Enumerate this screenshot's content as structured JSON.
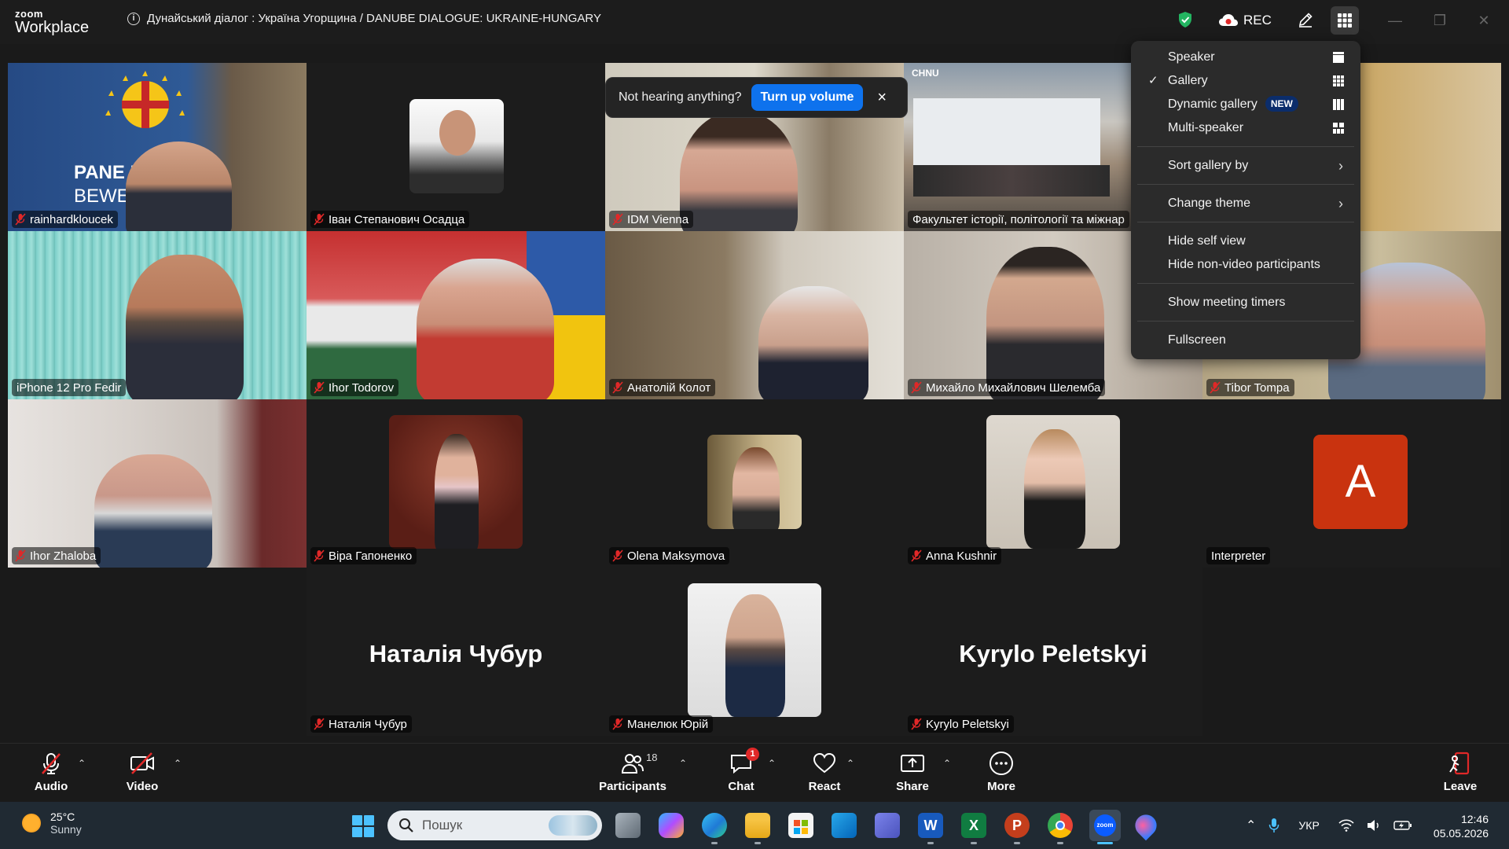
{
  "app": {
    "brand_top": "zoom",
    "brand_bottom": "Workplace"
  },
  "meeting": {
    "title": "Дунайський діалог : Україна Угорщина / DANUBE DIALOGUE: UKRAINE-HUNGARY"
  },
  "header": {
    "rec_label": "REC"
  },
  "notification": {
    "text": "Not hearing anything?",
    "button": "Turn up volume",
    "close": "×"
  },
  "view_menu": {
    "items": [
      {
        "label": "Speaker",
        "checked": false
      },
      {
        "label": "Gallery",
        "checked": true
      },
      {
        "label": "Dynamic gallery",
        "badge": "NEW",
        "checked": false
      },
      {
        "label": "Multi-speaker",
        "checked": false
      }
    ],
    "sort_gallery": "Sort gallery by",
    "change_theme": "Change theme",
    "hide_self": "Hide self view",
    "hide_nonvideo": "Hide non-video participants",
    "show_timers": "Show meeting timers",
    "fullscreen": "Fullscreen",
    "check_mark": "✓"
  },
  "participants": [
    {
      "name": "rainhardkloucek",
      "muted": true
    },
    {
      "name": "Іван Степанович Осадца",
      "muted": true
    },
    {
      "name": "IDM Vienna",
      "muted": true
    },
    {
      "name": "Факультет історії, політології та міжнар",
      "muted": false
    },
    {
      "name": "iPhone 12 Pro Fedir",
      "muted": false
    },
    {
      "name": "Ihor Todorov",
      "muted": true
    },
    {
      "name": "Анатолій Колот",
      "muted": true
    },
    {
      "name": "Михайло Михайлович Шелемба",
      "muted": true
    },
    {
      "name": "Tibor Tompa",
      "muted": true
    },
    {
      "name": "Ihor Zhaloba",
      "muted": true
    },
    {
      "name": "Віра Гапоненко",
      "muted": true
    },
    {
      "name": "Olena Maksymova",
      "muted": true
    },
    {
      "name": "Anna Kushnir",
      "muted": true
    },
    {
      "name": "Interpreter",
      "muted": false,
      "avatar_letter": "A"
    },
    {
      "name": "Наталія Чубур",
      "muted": true,
      "big_name": "Наталія Чубур"
    },
    {
      "name": "Манелюк Юрій",
      "muted": true
    },
    {
      "name": "Kyrylo Peletskyi",
      "muted": true,
      "big_name": "Kyrylo Peletskyi"
    }
  ],
  "tile_texts": {
    "panel_sign_1": "PANE  ROPA",
    "panel_sign_2": "BEWE  NG",
    "university_logo": "CHNU"
  },
  "toolbar": {
    "audio": "Audio",
    "video": "Video",
    "participants": "Participants",
    "participants_count": "18",
    "chat": "Chat",
    "chat_badge": "1",
    "react": "React",
    "share": "Share",
    "more": "More",
    "leave": "Leave"
  },
  "taskbar": {
    "temp": "25°C",
    "weather": "Sunny",
    "search_placeholder": "Пошук",
    "lang": "УКР",
    "time": "12:46",
    "date": "05.05.2026"
  },
  "colors": {
    "accent": "#0e72ed",
    "active_speaker": "#2dd37a",
    "muted_red": "#e02828",
    "avatar_orange": "#c9330f"
  }
}
